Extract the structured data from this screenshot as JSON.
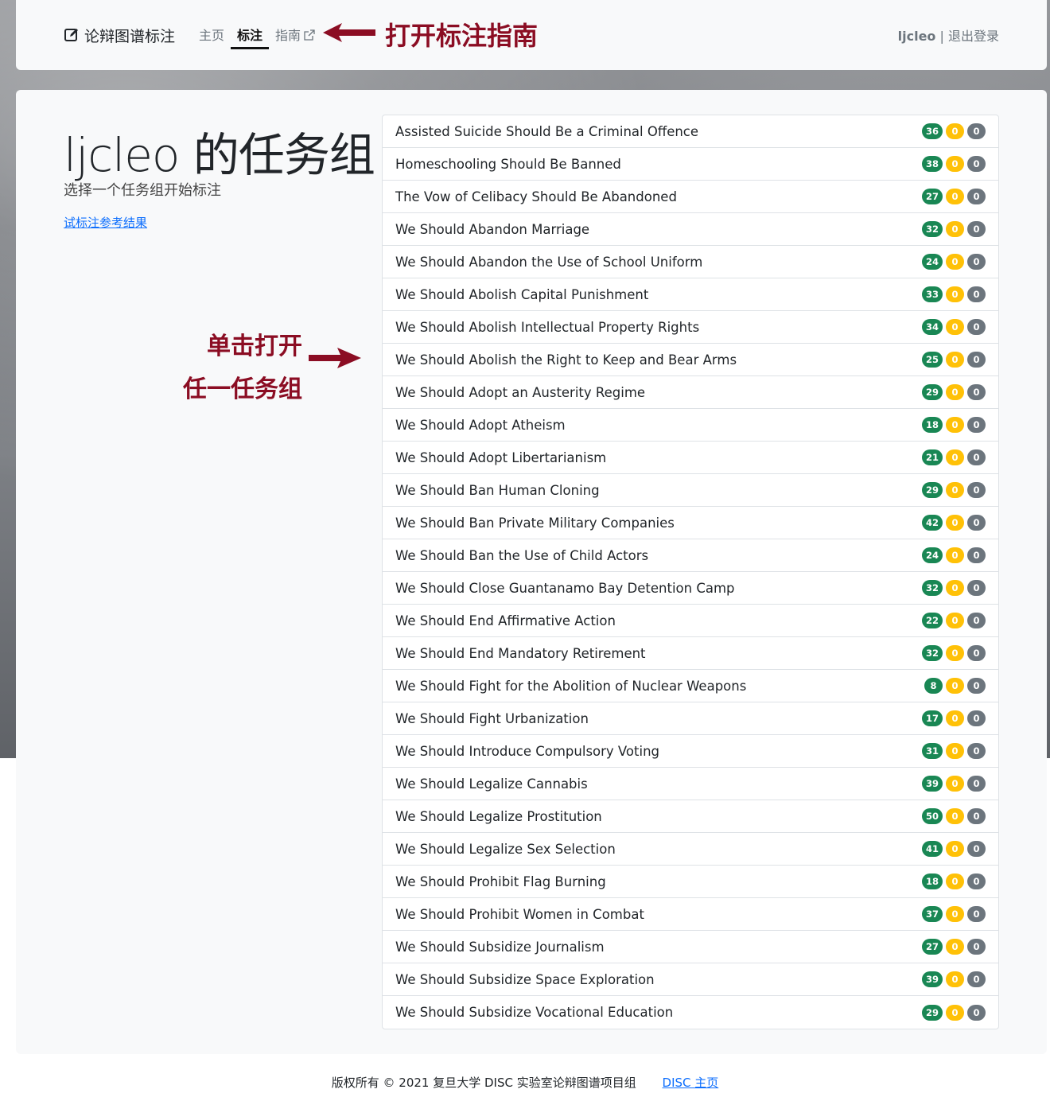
{
  "navbar": {
    "brand": "论辩图谱标注",
    "links": [
      {
        "label": "主页"
      },
      {
        "label": "标注"
      },
      {
        "label": "指南"
      }
    ],
    "user": "ljcleo",
    "separator": "|",
    "logout": "退出登录"
  },
  "annotations": {
    "top": "打开标注指南",
    "left_line1": "单击打开",
    "left_line2": "任一任务组",
    "color": "#8b0d23"
  },
  "page": {
    "title": "ljcleo 的任务组",
    "subtitle": "选择一个任务组开始标注",
    "trial_link": "试标注参考结果"
  },
  "tasks": [
    {
      "name": "Assisted Suicide Should Be a Criminal Offence",
      "green": "36",
      "yellow": "0",
      "gray": "0"
    },
    {
      "name": "Homeschooling Should Be Banned",
      "green": "38",
      "yellow": "0",
      "gray": "0"
    },
    {
      "name": "The Vow of Celibacy Should Be Abandoned",
      "green": "27",
      "yellow": "0",
      "gray": "0"
    },
    {
      "name": "We Should Abandon Marriage",
      "green": "32",
      "yellow": "0",
      "gray": "0"
    },
    {
      "name": "We Should Abandon the Use of School Uniform",
      "green": "24",
      "yellow": "0",
      "gray": "0"
    },
    {
      "name": "We Should Abolish Capital Punishment",
      "green": "33",
      "yellow": "0",
      "gray": "0"
    },
    {
      "name": "We Should Abolish Intellectual Property Rights",
      "green": "34",
      "yellow": "0",
      "gray": "0"
    },
    {
      "name": "We Should Abolish the Right to Keep and Bear Arms",
      "green": "25",
      "yellow": "0",
      "gray": "0"
    },
    {
      "name": "We Should Adopt an Austerity Regime",
      "green": "29",
      "yellow": "0",
      "gray": "0"
    },
    {
      "name": "We Should Adopt Atheism",
      "green": "18",
      "yellow": "0",
      "gray": "0"
    },
    {
      "name": "We Should Adopt Libertarianism",
      "green": "21",
      "yellow": "0",
      "gray": "0"
    },
    {
      "name": "We Should Ban Human Cloning",
      "green": "29",
      "yellow": "0",
      "gray": "0"
    },
    {
      "name": "We Should Ban Private Military Companies",
      "green": "42",
      "yellow": "0",
      "gray": "0"
    },
    {
      "name": "We Should Ban the Use of Child Actors",
      "green": "24",
      "yellow": "0",
      "gray": "0"
    },
    {
      "name": "We Should Close Guantanamo Bay Detention Camp",
      "green": "32",
      "yellow": "0",
      "gray": "0"
    },
    {
      "name": "We Should End Affirmative Action",
      "green": "22",
      "yellow": "0",
      "gray": "0"
    },
    {
      "name": "We Should End Mandatory Retirement",
      "green": "32",
      "yellow": "0",
      "gray": "0"
    },
    {
      "name": "We Should Fight for the Abolition of Nuclear Weapons",
      "green": "8",
      "yellow": "0",
      "gray": "0"
    },
    {
      "name": "We Should Fight Urbanization",
      "green": "17",
      "yellow": "0",
      "gray": "0"
    },
    {
      "name": "We Should Introduce Compulsory Voting",
      "green": "31",
      "yellow": "0",
      "gray": "0"
    },
    {
      "name": "We Should Legalize Cannabis",
      "green": "39",
      "yellow": "0",
      "gray": "0"
    },
    {
      "name": "We Should Legalize Prostitution",
      "green": "50",
      "yellow": "0",
      "gray": "0"
    },
    {
      "name": "We Should Legalize Sex Selection",
      "green": "41",
      "yellow": "0",
      "gray": "0"
    },
    {
      "name": "We Should Prohibit Flag Burning",
      "green": "18",
      "yellow": "0",
      "gray": "0"
    },
    {
      "name": "We Should Prohibit Women in Combat",
      "green": "37",
      "yellow": "0",
      "gray": "0"
    },
    {
      "name": "We Should Subsidize Journalism",
      "green": "27",
      "yellow": "0",
      "gray": "0"
    },
    {
      "name": "We Should Subsidize Space Exploration",
      "green": "39",
      "yellow": "0",
      "gray": "0"
    },
    {
      "name": "We Should Subsidize Vocational Education",
      "green": "29",
      "yellow": "0",
      "gray": "0"
    }
  ],
  "footer": {
    "copyright": "版权所有 © 2021 复旦大学 DISC 实验室论辩图谱项目组",
    "link": "DISC 主页"
  },
  "colors": {
    "badge_green": "#198754",
    "badge_yellow": "#ffc107",
    "badge_gray": "#6c757d",
    "link": "#0d6efd"
  },
  "icons": {
    "brand": "edit-square-icon",
    "guide_external": "external-link-icon",
    "top_arrow": "arrow-left-icon",
    "left_arrow": "arrow-right-icon"
  }
}
